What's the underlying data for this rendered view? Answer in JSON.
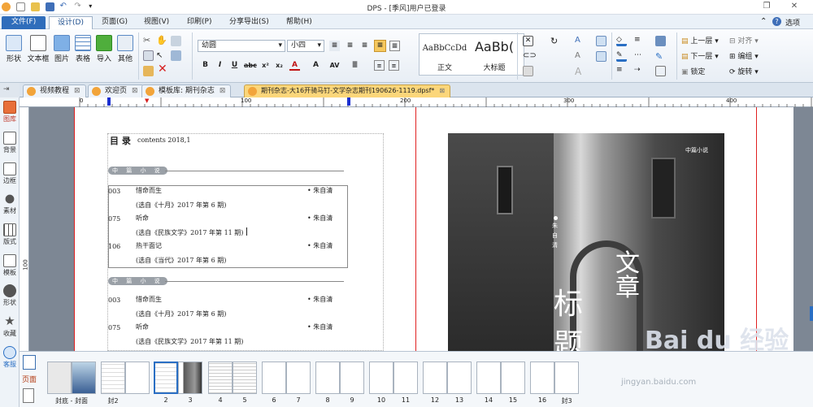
{
  "titlebar": {
    "title": "DPS - [季风]用户已登录",
    "options_label": "选项"
  },
  "menu": {
    "items": [
      "文件(F)",
      "设计(D)",
      "页面(G)",
      "视图(V)",
      "印刷(P)",
      "分享导出(S)",
      "帮助(H)"
    ]
  },
  "ribbon": {
    "big_buttons": [
      "形状",
      "文本框",
      "图片",
      "表格",
      "导入",
      "其他"
    ],
    "font_name": "幼圆",
    "font_size": "小四",
    "style_samples": [
      {
        "sample": "AaBbCcDd",
        "name": "正文"
      },
      {
        "sample": "AaBb(",
        "name": "大标题"
      }
    ],
    "layer_buttons": [
      "上一层",
      "对齐",
      "下一层",
      "编组",
      "锁定",
      "旋转"
    ]
  },
  "tabs": [
    "视频教程",
    "欢迎页",
    "模板库: 期刊杂志",
    "期刊杂志-大16开骑马钉-文学杂志期刊190626-1119.dpsf*"
  ],
  "leftbar": [
    "图库",
    "背景",
    "边框",
    "素材",
    "版式",
    "模板",
    "形状",
    "收藏",
    "客服"
  ],
  "ruler": {
    "h_ticks": [
      "0",
      "100",
      "200",
      "300",
      "400"
    ],
    "v_tick": "100"
  },
  "toc": {
    "title": "目 录",
    "subtitle": "contents 2018,1",
    "sections": [
      {
        "label": "中 篇 小 说",
        "entries": [
          {
            "page": "003",
            "title": "惜命而生",
            "author": "• 朱自清",
            "source": "(选自《十月》2017 年第 6 期)"
          },
          {
            "page": "075",
            "title": "听命",
            "author": "• 朱自清",
            "source": "(选自《民族文学》2017 年第 11 期)"
          },
          {
            "page": "106",
            "title": "热干面记",
            "author": "• 朱自清",
            "source": "(选自《当代》2017 年第 6 期)"
          }
        ]
      },
      {
        "label": "中 篇 小 说",
        "entries": [
          {
            "page": "003",
            "title": "惜命而生",
            "author": "• 朱自清",
            "source": "(选自《十月》2017 年第 6 期)"
          },
          {
            "page": "075",
            "title": "听命",
            "author": "• 朱自清",
            "source": "(选自《民族文学》2017 年第 11 期)"
          }
        ]
      }
    ]
  },
  "photo": {
    "corner": "中篇小说",
    "vertical": "朱 自 清",
    "big1": "文章",
    "big2": "标题"
  },
  "watermark": {
    "main": "Bai du 经验",
    "url": "jingyan.baidu.com"
  },
  "thumbs": {
    "side_label": "页面",
    "labels": [
      "封底 - 封面",
      "封2",
      "2",
      "3",
      "4",
      "5",
      "6",
      "7",
      "8",
      "9",
      "10",
      "11",
      "12",
      "13",
      "14",
      "15",
      "16",
      "封3"
    ]
  }
}
